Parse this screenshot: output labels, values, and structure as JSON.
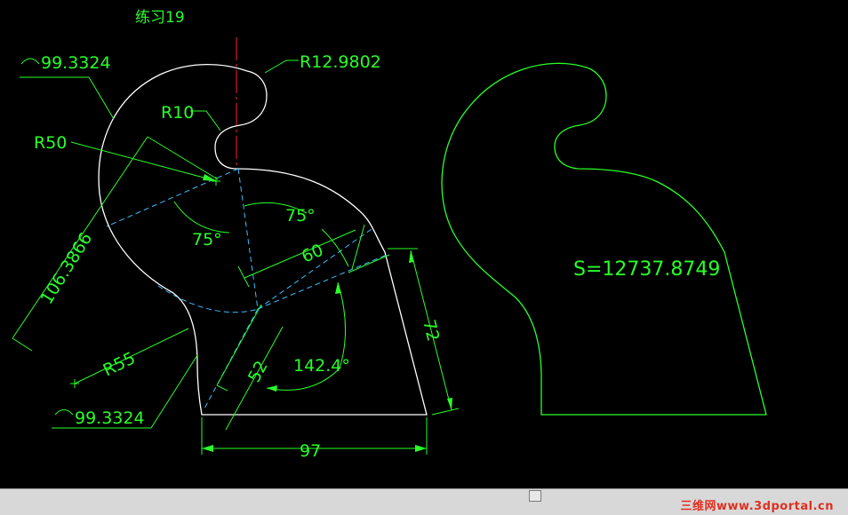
{
  "title": "练习19",
  "labels": {
    "arc_top": "99.3324",
    "arc_bottom": "99.3324",
    "r_top": "R12.9802",
    "r10": "R10",
    "r50": "R50",
    "r55": "R55",
    "len_slant": "106.3866",
    "ang_left": "75°",
    "ang_right": "75°",
    "dim_60": "60",
    "dim_72": "72",
    "dim_52": "52",
    "ang_1424": "142.4°",
    "dim_97": "97",
    "area": "S=12737.8749"
  },
  "watermark": "三维网www.3dportal.cn",
  "colors": {
    "background": "#000000",
    "dimension": "#29ff29",
    "outline": "#ffffff",
    "construction": "#3fbfff",
    "centerline": "#ff2020",
    "watermark": "#e03020"
  }
}
